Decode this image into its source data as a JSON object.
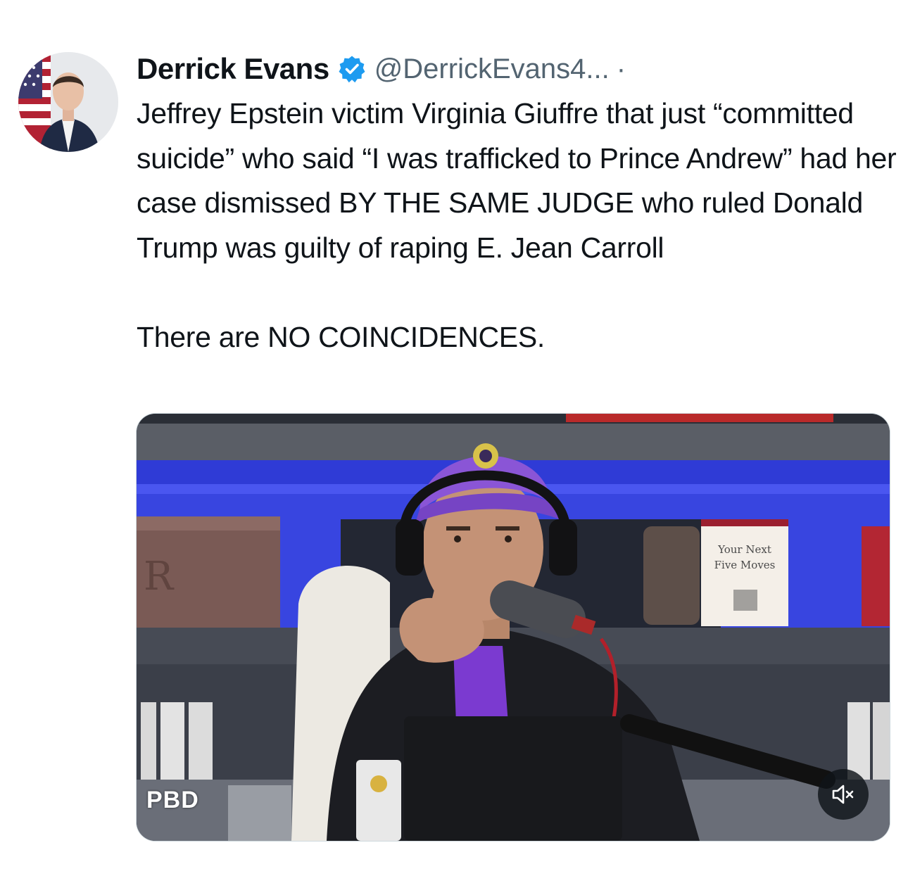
{
  "author": {
    "display_name": "Derrick Evans",
    "handle": "@DerrickEvans4...",
    "separator": "·",
    "verified": true,
    "verified_color": "#1d9bf0",
    "avatar_icon": "profile-photo"
  },
  "tweet": {
    "text": "Jeffrey Epstein victim Virginia Giuffre that just “committed suicide” who said “I was trafficked to Prince Andrew” had her case dismissed BY THE SAME JUDGE who ruled Donald Trump was guilty of raping E. Jean Carroll\n\nThere are NO COINCIDENCES."
  },
  "media": {
    "type": "video",
    "watermark": "PBD",
    "book_title": "Your Next Five Moves",
    "mute_icon": "speaker-muted-icon"
  },
  "colors": {
    "text": "#0f1419",
    "secondary": "#536471",
    "accent": "#1d9bf0"
  }
}
